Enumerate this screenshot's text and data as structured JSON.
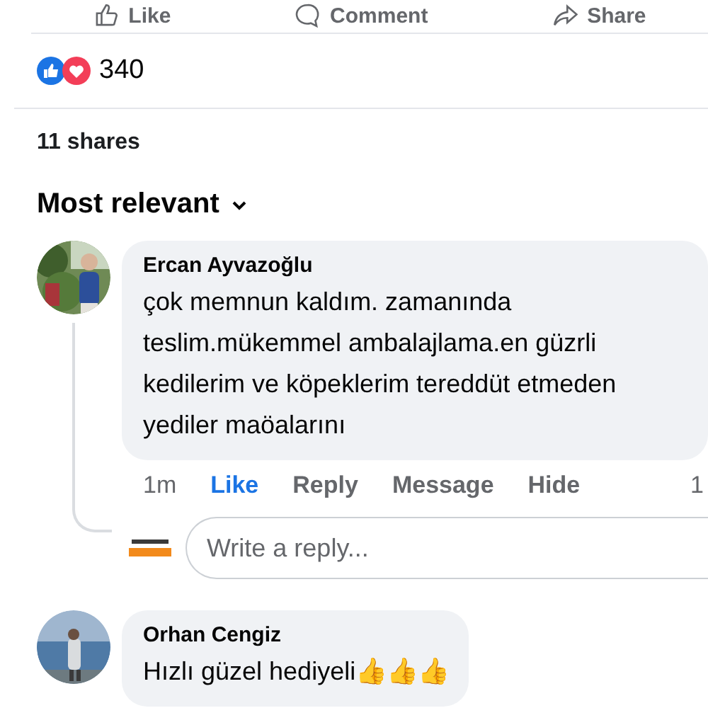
{
  "actions": [
    {
      "label": "Like",
      "kind": "like"
    },
    {
      "label": "Comment",
      "kind": "comment"
    },
    {
      "label": "Share",
      "kind": "share"
    }
  ],
  "reactions": {
    "count": "340"
  },
  "shares": "11 shares",
  "sort": {
    "label": "Most relevant"
  },
  "comments": [
    {
      "author": "Ercan Ayvazoğlu",
      "text": "çok memnun kaldım. zamanında teslim.mükemmel ambalajlama.en güzrli kedilerim ve köpeklerim tereddüt etmeden yediler maöalarını",
      "links": [
        {
          "label": "1m",
          "kind": "time"
        },
        {
          "label": "Like",
          "kind": "link",
          "selected": true
        },
        {
          "label": "Reply",
          "kind": "link",
          "selected": false
        },
        {
          "label": "Message",
          "kind": "link",
          "selected": false
        },
        {
          "label": "Hide",
          "kind": "link",
          "selected": false
        }
      ],
      "reaction_count": "1",
      "reply_box": {
        "placeholder": "Write a reply..."
      }
    },
    {
      "author": "Orhan Cengiz",
      "text": "Hızlı güzel hediyeli👍👍👍"
    }
  ]
}
